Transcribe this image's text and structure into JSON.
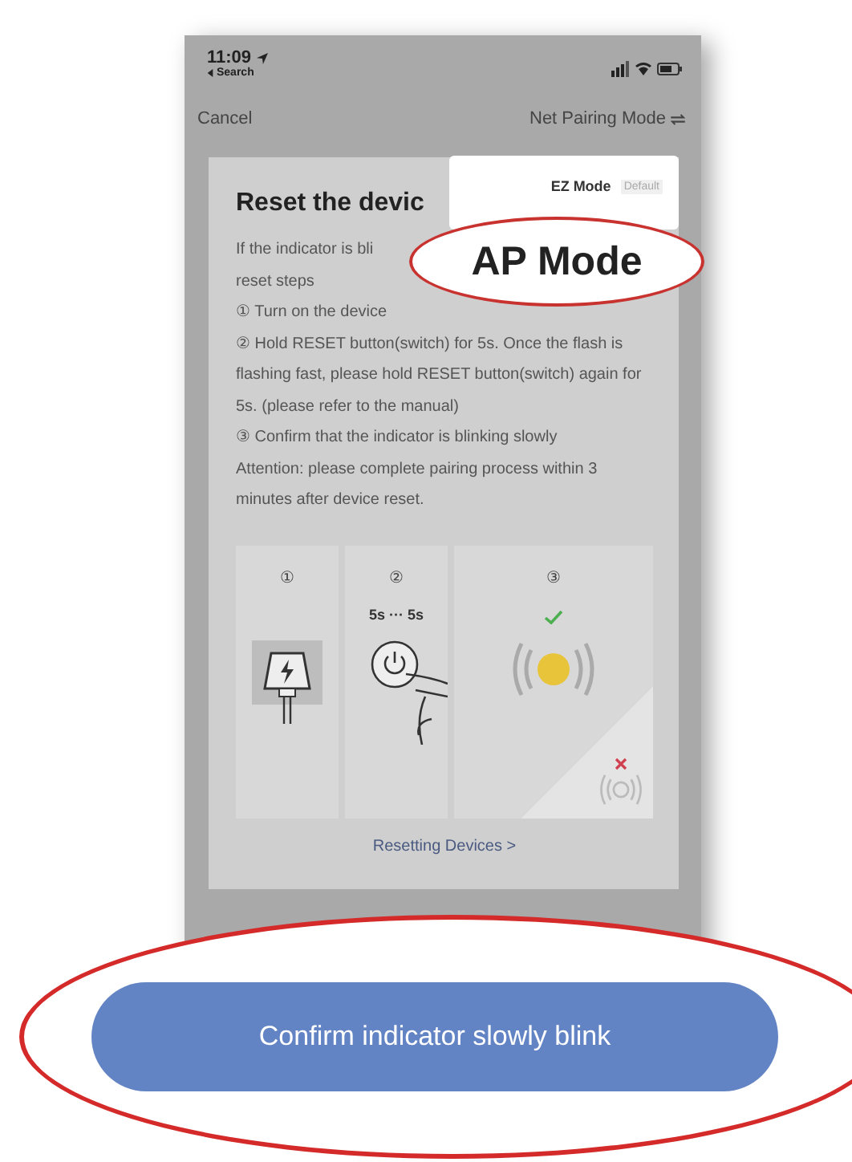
{
  "status_bar": {
    "time": "11:09",
    "back_label": "Search"
  },
  "nav": {
    "cancel": "Cancel",
    "title": "Net Pairing Mode"
  },
  "mode_menu": {
    "items": [
      {
        "label": "EZ Mode",
        "badge": "Default"
      }
    ]
  },
  "callout": {
    "label": "AP Mode"
  },
  "card": {
    "title": "Reset the devic",
    "lines": [
      "If the indicator is bli",
      "reset steps",
      "① Turn on the device",
      "② Hold RESET button(switch) for 5s. Once the flash is flashing fast, please hold RESET button(switch) again for 5s. (please refer to the manual)",
      "③ Confirm that the indicator is blinking slowly",
      "Attention: please complete pairing process within 3 minutes after device reset."
    ],
    "steps": [
      {
        "number": "①",
        "kind": "plug"
      },
      {
        "number": "②",
        "caption": "5s ··· 5s",
        "kind": "press"
      },
      {
        "number": "③",
        "kind": "blink"
      }
    ],
    "link": "Resetting Devices >"
  },
  "button": {
    "label": "Confirm indicator slowly blink"
  }
}
